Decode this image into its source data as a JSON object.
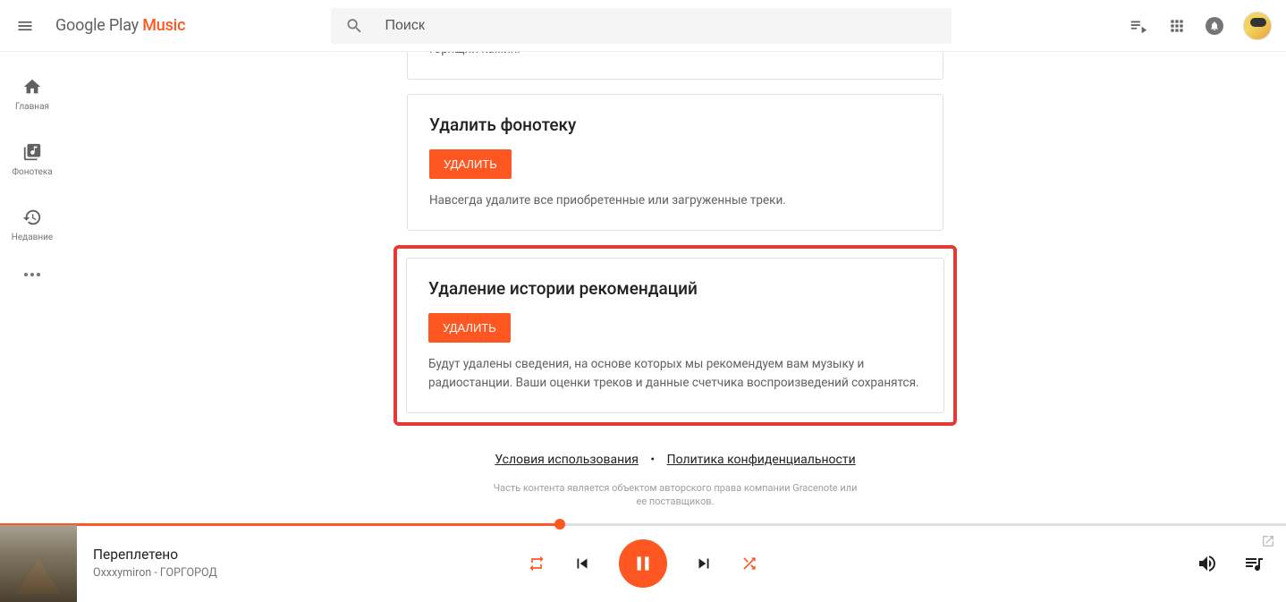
{
  "header": {
    "logo_part1": "Google Play ",
    "logo_part2": "Music",
    "search_placeholder": "Поиск"
  },
  "sidebar": {
    "home": "Главная",
    "library": "Фонотека",
    "recent": "Недавние"
  },
  "cards": {
    "partial_desc": "горящий камин.",
    "delete_library": {
      "title": "Удалить фонотеку",
      "button": "УДАЛИТЬ",
      "desc": "Навсегда удалите все приобретенные или загруженные треки."
    },
    "delete_recs": {
      "title": "Удаление истории рекомендаций",
      "button": "УДАЛИТЬ",
      "desc": "Будут удалены сведения, на основе которых мы рекомендуем вам музыку и радиостанции. Ваши оценки треков и данные счетчика воспроизведений сохранятся."
    }
  },
  "footer": {
    "terms": "Условия использования",
    "privacy": "Политика конфиденциальности",
    "note": "Часть контента является объектом авторского права компании Gracenote или ее поставщиков."
  },
  "player": {
    "title": "Переплетено",
    "artist": "Oxxxymiron - ГОРГОРОД"
  }
}
